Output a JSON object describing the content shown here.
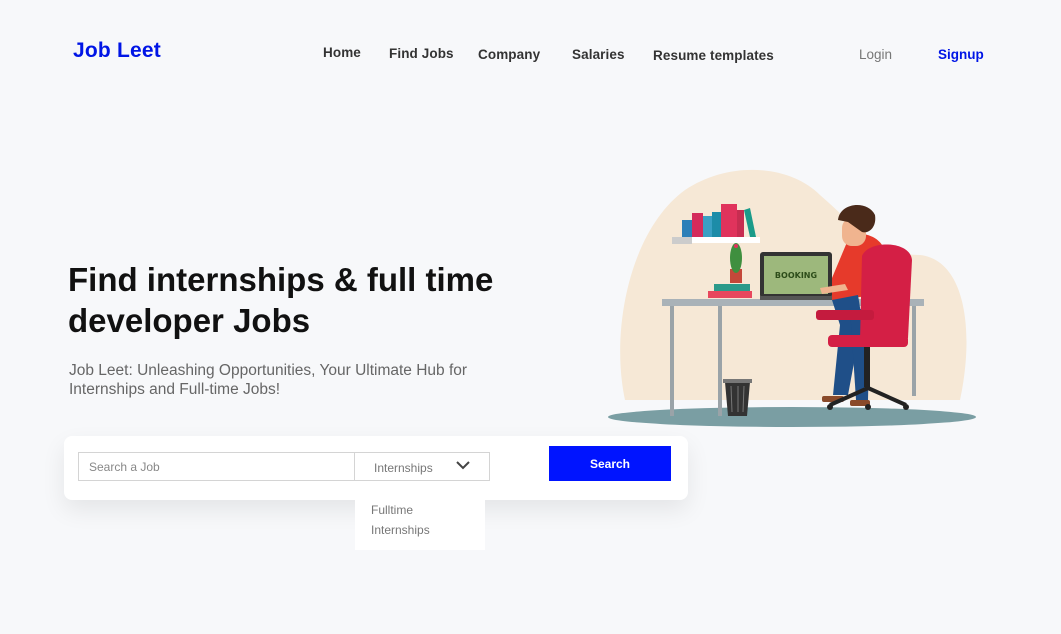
{
  "header": {
    "logo": "Job Leet",
    "nav": [
      "Home",
      "Find Jobs",
      "Company",
      "Salaries",
      "Resume templates"
    ],
    "login": "Login",
    "signup": "Signup"
  },
  "hero": {
    "title": "Find internships & full time developer Jobs",
    "subtitle": "Job Leet: Unleashing Opportunities, Your Ultimate Hub for Internships and Full-time Jobs!"
  },
  "search": {
    "placeholder": "Search a Job",
    "selected_type": "Internships",
    "button_label": "Search",
    "options": [
      "Fulltime",
      "Internships"
    ]
  },
  "illustration": {
    "screen_text": "BOOKING"
  },
  "colors": {
    "brand": "#0015e6",
    "button": "#0014ff",
    "background": "#f7f8fa",
    "chair": "#d41f45"
  }
}
